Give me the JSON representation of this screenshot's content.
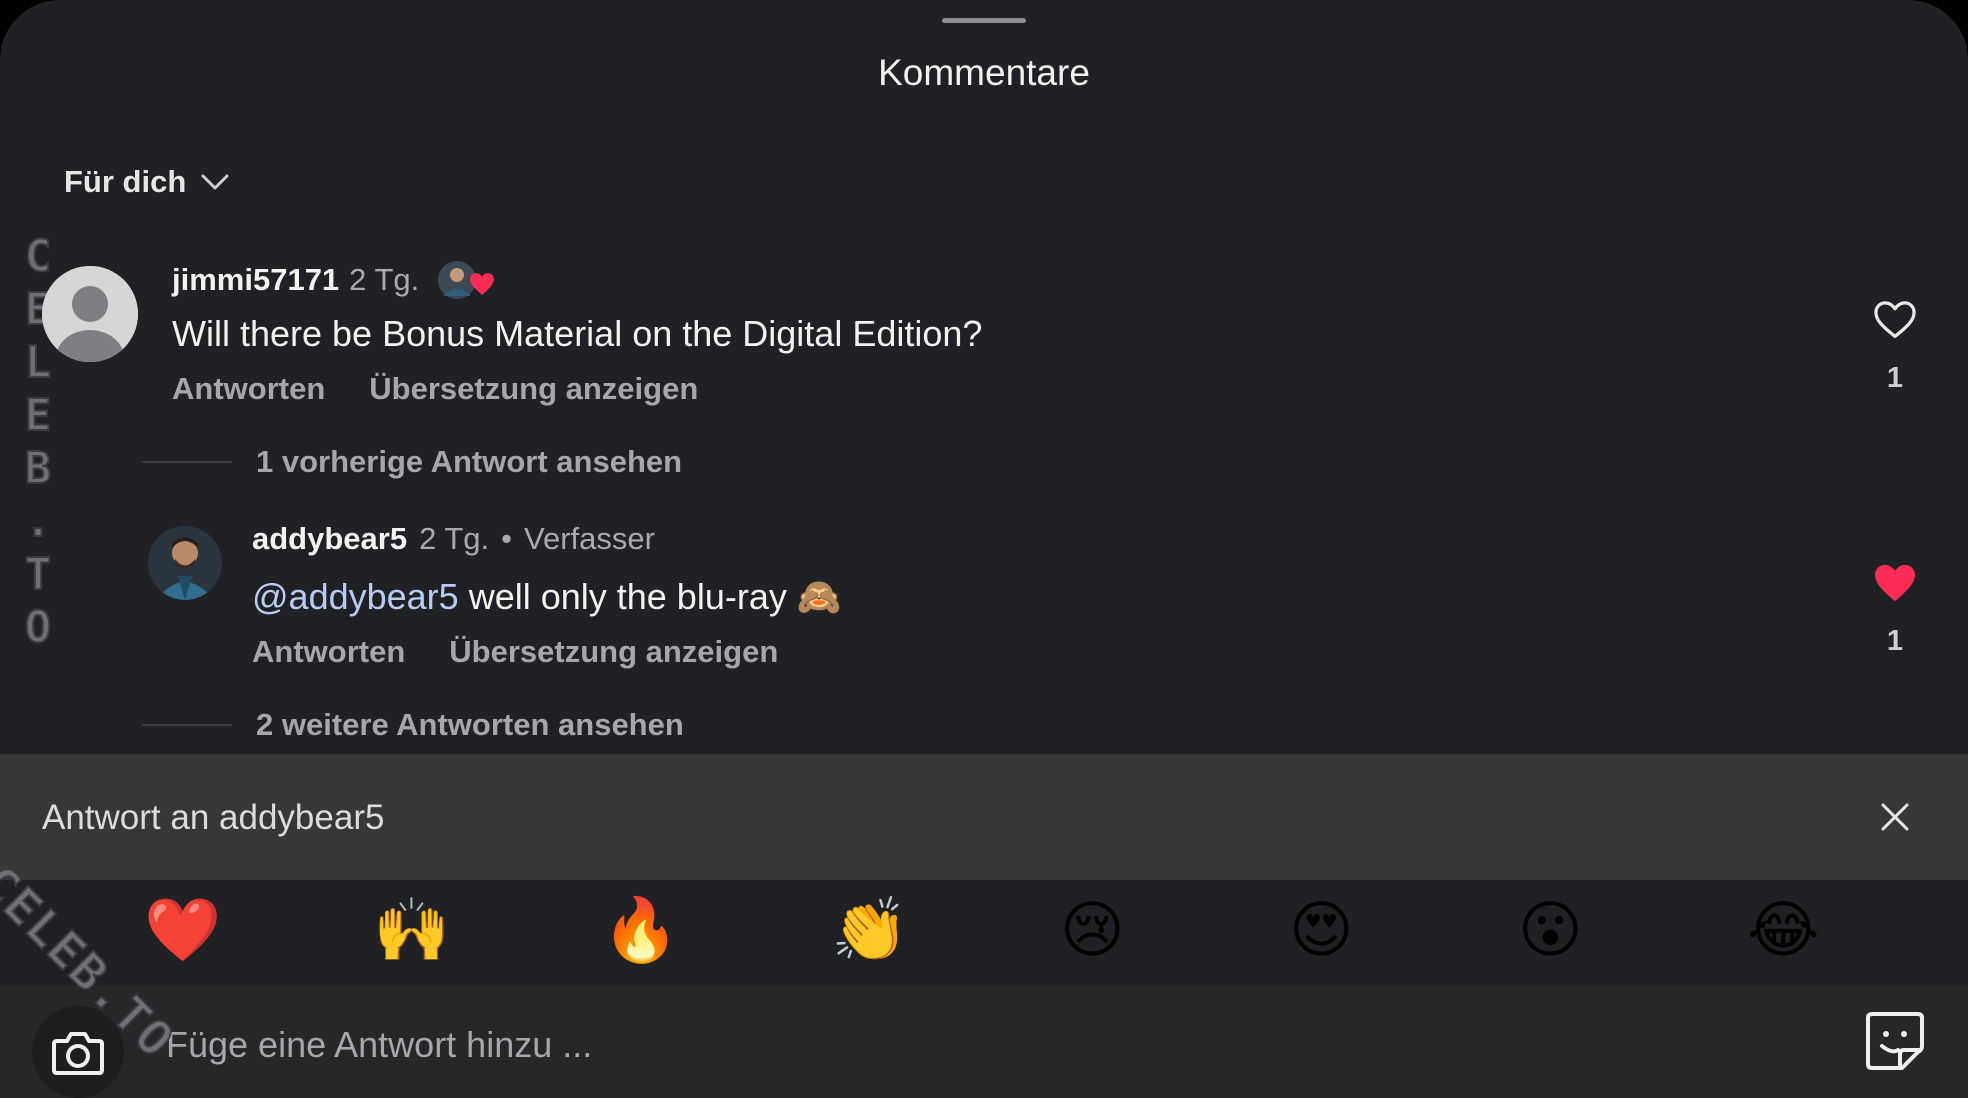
{
  "header": {
    "title": "Kommentare"
  },
  "sort": {
    "label": "Für dich"
  },
  "watermark": {
    "vertical": [
      "C",
      "E",
      "L",
      "E",
      "B",
      ".",
      "T",
      "O"
    ],
    "diagonal": "CELEB.TO"
  },
  "comments": [
    {
      "username": "jimmi57171",
      "time": "2 Tg.",
      "text": "Will there be Bonus Material on the Digital Edition?",
      "reply_label": "Antworten",
      "translate_label": "Übersetzung anzeigen",
      "likes": "1",
      "liked": false
    }
  ],
  "replies_prev": "1 vorherige Antwort ansehen",
  "reply": {
    "username": "addybear5",
    "time": "2 Tg.",
    "separator": "•",
    "badge": "Verfasser",
    "mention": "@addybear5",
    "text": " well only the blu-ray 🙈",
    "reply_label": "Antworten",
    "translate_label": "Übersetzung anzeigen",
    "likes": "1",
    "liked": true
  },
  "replies_more": "2 weitere Antworten ansehen",
  "reply_bar": {
    "label": "Antwort an addybear5"
  },
  "emojis": [
    "❤️",
    "🙌",
    "🔥",
    "👏",
    "😢",
    "😍",
    "😮",
    "😂"
  ],
  "input": {
    "placeholder": "Füge eine Antwort hinzu ..."
  },
  "colors": {
    "background": "#1f2124",
    "like_red": "#fe2c55",
    "mention": "#b9ccf5"
  }
}
